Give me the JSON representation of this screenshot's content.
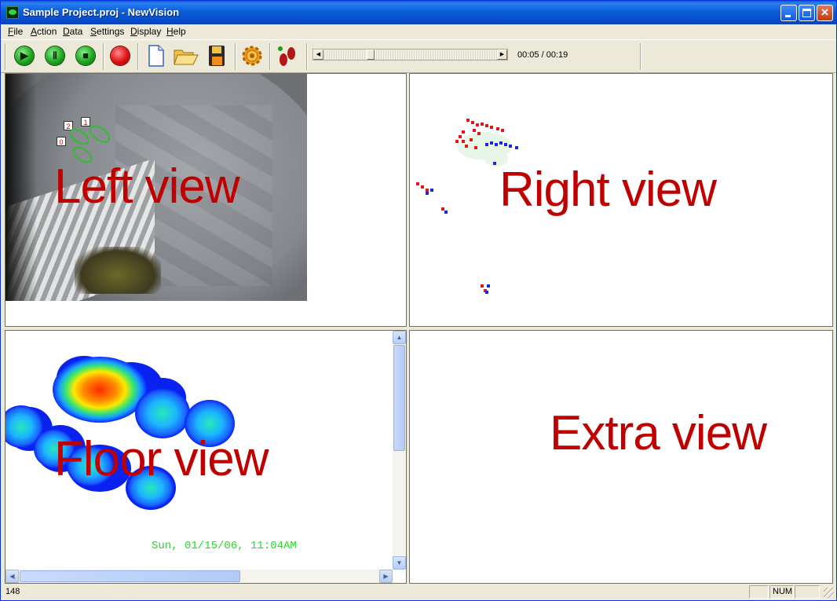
{
  "window": {
    "title": "Sample Project.proj - NewVision"
  },
  "menu": [
    "File",
    "Action",
    "Data",
    "Settings",
    "Display",
    "Help"
  ],
  "toolbar": {
    "buttons": [
      "play-icon",
      "pause-icon",
      "stop-icon",
      "record-icon",
      "new-file-icon",
      "open-folder-icon",
      "save-icon",
      "settings-gear-icon",
      "footprints-icon"
    ],
    "time": "00:05 / 00:19",
    "playback_position": 0.26
  },
  "views": {
    "left": {
      "label": "Left view",
      "tracks": [
        "2",
        "1",
        "0"
      ]
    },
    "right": {
      "label": "Right view"
    },
    "floor": {
      "label": "Floor view",
      "timestamp": "Sun, 01/15/06, 11:04AM"
    },
    "extra": {
      "label": "Extra view"
    }
  },
  "status": {
    "text": "148",
    "num": "NUM"
  },
  "colors": {
    "label": "#c00000",
    "timestamp": "#22dd22",
    "track_outline": "#2fbd2f"
  }
}
